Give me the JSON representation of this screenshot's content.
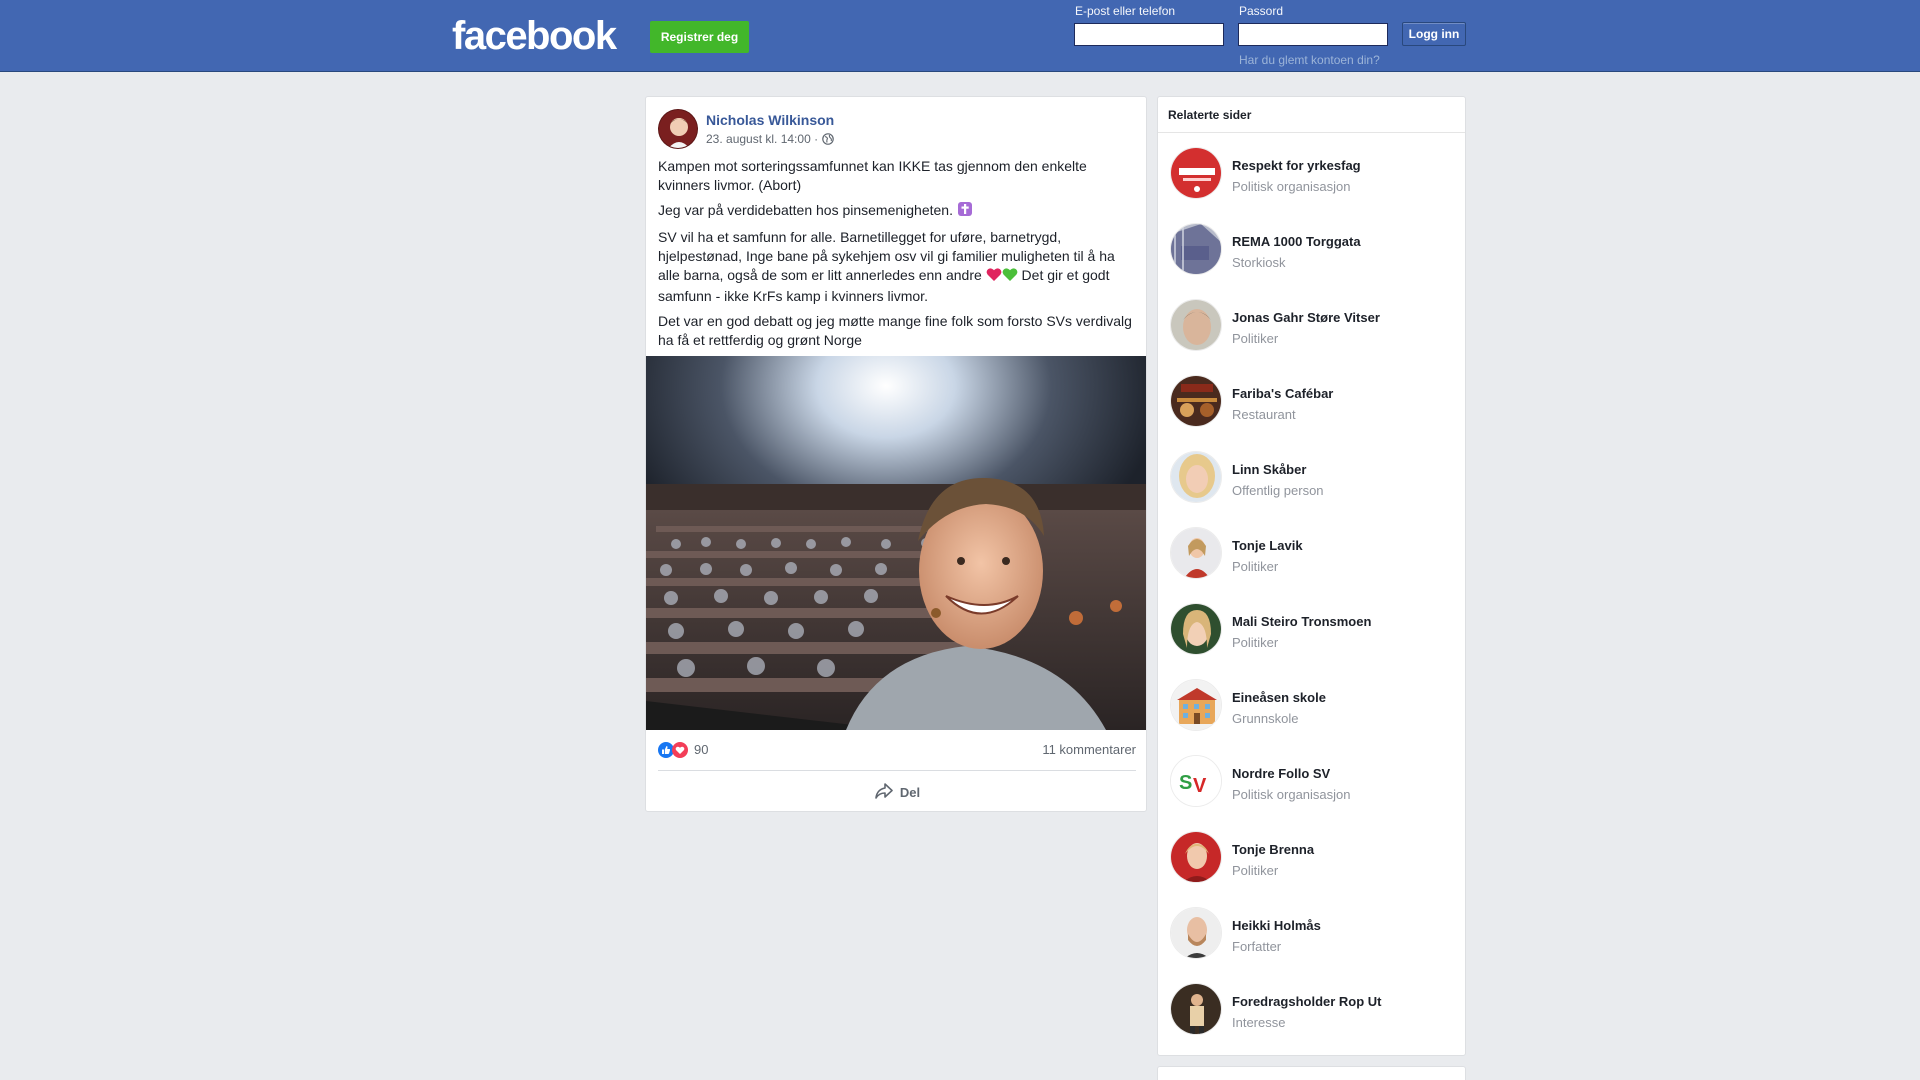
{
  "header": {
    "logo": "facebook",
    "register_label": "Registrer deg",
    "email_label": "E-post eller telefon",
    "email_value": "",
    "password_label": "Passord",
    "password_value": "",
    "forgot_label": "Har du glemt kontoen din?",
    "login_label": "Logg inn",
    "colors": {
      "bar": "#4267b2",
      "register": "#42b72a"
    }
  },
  "post": {
    "author": "Nicholas Wilkinson",
    "timestamp": "23. august kl. 14:00 ·",
    "paragraphs": [
      {
        "text": "Kampen mot sorteringssamfunnet kan IKKE tas gjennom den enkelte kvinners livmor. (Abort)",
        "emoji": ""
      },
      {
        "text": "Jeg var på verdidebatten hos pinsemenigheten.",
        "emoji": "cross-emoji"
      },
      {
        "text": "SV vil ha et samfunn for alle. Barnetillegget for uføre, barnetrygd, hjelpestønad, Inge bane på sykehjem osv vil gi familier muligheten til å ha alle barna, også de som er litt annerledes enn andre",
        "emoji": "heart-emojis",
        "text_after": " Det gir et godt samfunn - ikke KrFs kamp i kvinners livmor."
      },
      {
        "text": "Det var en god debatt og jeg møtte mange fine folk som forsto SVs verdivalg ha få et rettferdig og grønt Norge",
        "emoji": ""
      }
    ],
    "reaction_count": "90",
    "comment_count": "11 kommentarer",
    "share_label": "Del"
  },
  "related": {
    "title": "Relaterte sider",
    "items": [
      {
        "name": "Respekt for yrkesfag",
        "category": "Politisk organisasjon",
        "color": "#d32f2f"
      },
      {
        "name": "REMA 1000 Torggata",
        "category": "Storkiosk",
        "color": "#5a5f8c"
      },
      {
        "name": "Jonas Gahr Støre Vitser",
        "category": "Politiker",
        "color": "#8a8a82"
      },
      {
        "name": "Fariba's Cafébar",
        "category": "Restaurant",
        "color": "#4a2a1e"
      },
      {
        "name": "Linn Skåber",
        "category": "Offentlig person",
        "color": "#e8c9a0"
      },
      {
        "name": "Tonje Lavik",
        "category": "Politiker",
        "color": "#c0392b"
      },
      {
        "name": "Mali Steiro Tronsmoen",
        "category": "Politiker",
        "color": "#2f4f2f"
      },
      {
        "name": "Eineåsen skole",
        "category": "Grunnskole",
        "color": "#f2f2f2"
      },
      {
        "name": "Nordre Follo SV",
        "category": "Politisk organisasjon",
        "color": "#ffffff"
      },
      {
        "name": "Tonje Brenna",
        "category": "Politiker",
        "color": "#c62828"
      },
      {
        "name": "Heikki Holmås",
        "category": "Forfatter",
        "color": "#eeeeee"
      },
      {
        "name": "Foredragsholder Rop Ut",
        "category": "Interesse",
        "color": "#3a2d22"
      }
    ]
  }
}
